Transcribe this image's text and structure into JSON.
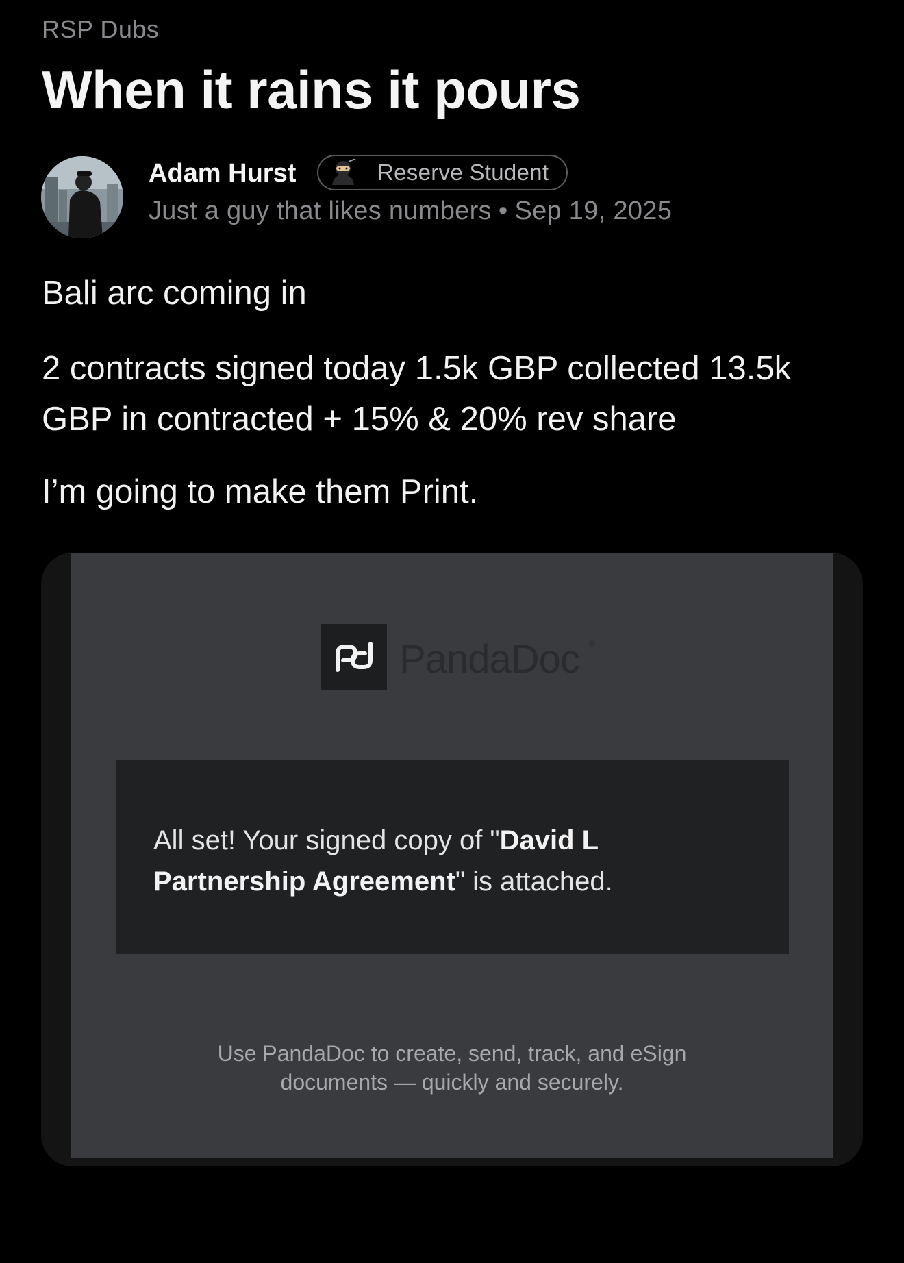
{
  "post": {
    "category": "RSP Dubs",
    "title": "When it rains it pours",
    "author": {
      "name": "Adam Hurst",
      "badge_label": "Reserve Student",
      "badge_icon": "ninja-icon",
      "bio": "Just a guy that likes numbers",
      "separator": "•",
      "date": "Sep 19, 2025"
    },
    "body": [
      "Bali arc coming in",
      "2 contracts signed today 1.5k GBP collected 13.5k GBP in contracted +  15% & 20% rev share",
      "I’m going to make them Print."
    ]
  },
  "attachment": {
    "logo_icon": "pandadoc-logo-icon",
    "brand": "PandaDoc",
    "trademark": "®",
    "message_prefix": "All set! Your signed copy of \"",
    "message_bold": "David L Partnership Agreement",
    "message_suffix": "\" is attached.",
    "footer_line1": "Use PandaDoc to create, send, track, and eSign",
    "footer_line2": "documents — quickly and securely."
  },
  "colors": {
    "background": "#000000",
    "muted_text": "#8a8a8e",
    "email_background": "#3a3b3e",
    "message_box": "#202123"
  }
}
